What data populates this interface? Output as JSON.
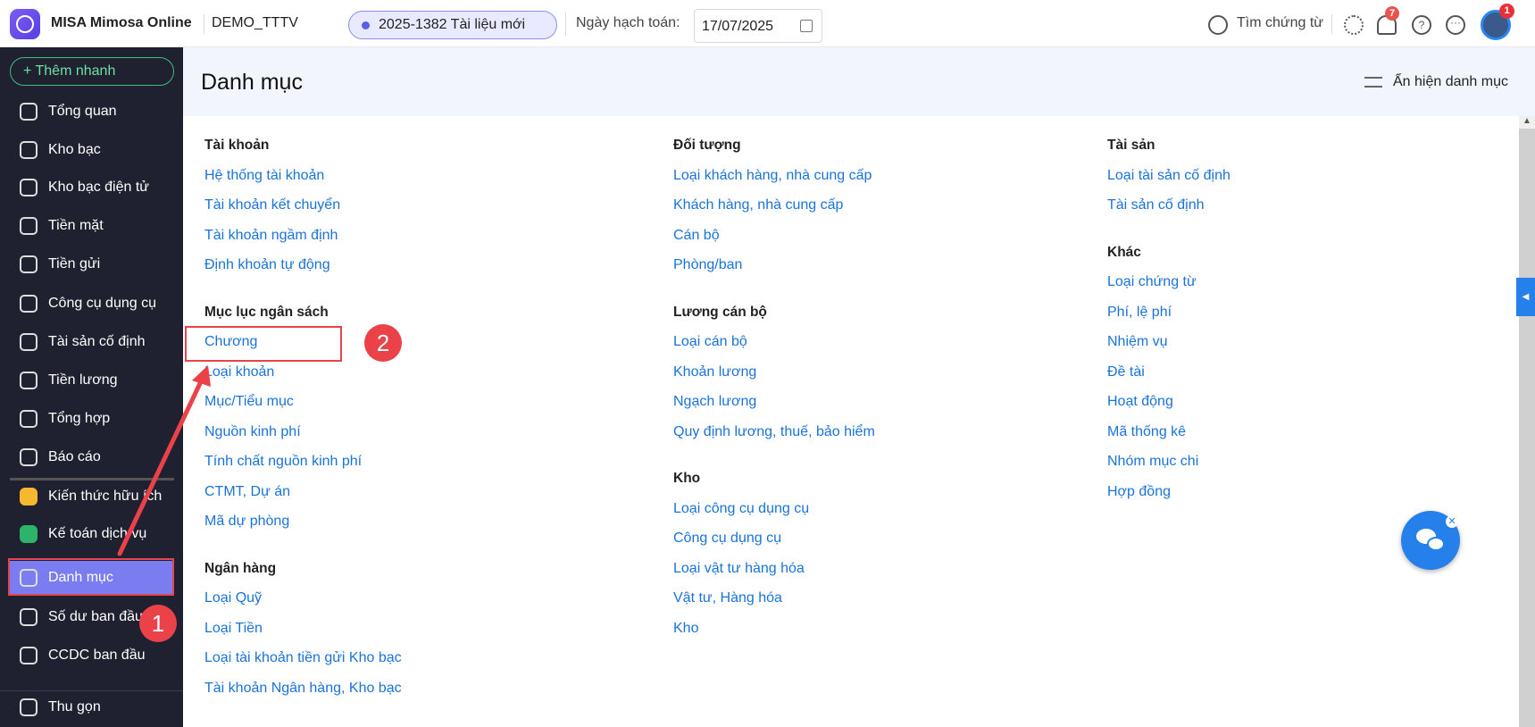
{
  "header": {
    "app_name": "MISA Mimosa Online",
    "org": "DEMO_TTTV",
    "doc_pill": "2025-1382 Tài liệu mới",
    "date_label": "Ngày hạch toán:",
    "date_value": "17/07/2025",
    "search_label": "Tìm chứng từ",
    "notif_count": "7",
    "avatar_badge": "1"
  },
  "sidebar": {
    "add_label": "Thêm nhanh",
    "items": [
      "Tổng quan",
      "Kho bạc",
      "Kho bạc điện tử",
      "Tiền mặt",
      "Tiền gửi",
      "Công cụ dụng cụ",
      "Tài sản cố định",
      "Tiền lương",
      "Tổng hợp",
      "Báo cáo"
    ],
    "extra": [
      "Kiến thức hữu ích",
      "Kế toán dịch vụ",
      "Danh mục",
      "Số dư ban đầu",
      "CCDC ban đầu"
    ],
    "collapse_label": "Thu gọn"
  },
  "main": {
    "title": "Danh mục",
    "toggle_label": "Ẩn hiện danh mục",
    "columns": [
      [
        {
          "h": "Tài khoản",
          "links": [
            "Hệ thống tài khoản",
            "Tài khoản kết chuyển",
            "Tài khoản ngầm định",
            "Định khoản tự động"
          ]
        },
        {
          "h": "Mục lục ngân sách",
          "links": [
            "Chương",
            "Loại khoản",
            "Mục/Tiểu mục",
            "Nguồn kinh phí",
            "Tính chất nguồn kinh phí",
            "CTMT, Dự án",
            "Mã dự phòng"
          ]
        },
        {
          "h": "Ngân hàng",
          "links": [
            "Loại Quỹ",
            "Loại Tiền",
            "Loại tài khoản tiền gửi Kho bạc",
            "Tài khoản Ngân hàng, Kho bạc"
          ]
        }
      ],
      [
        {
          "h": "Đối tượng",
          "links": [
            "Loại khách hàng, nhà cung cấp",
            "Khách hàng, nhà cung cấp",
            "Cán bộ",
            "Phòng/ban"
          ]
        },
        {
          "h": "Lương cán bộ",
          "links": [
            "Loại cán bộ",
            "Khoản lương",
            "Ngạch lương",
            "Quy định lương, thuế, bảo hiểm"
          ]
        },
        {
          "h": "Kho",
          "links": [
            "Loại công cụ dụng cụ",
            "Công cụ dụng cụ",
            "Loại vật tư hàng hóa",
            "Vật tư, Hàng hóa",
            "Kho"
          ]
        }
      ],
      [
        {
          "h": "Tài sản",
          "links": [
            "Loại tài sản cố định",
            "Tài sản cố định"
          ]
        },
        {
          "h": "Khác",
          "links": [
            "Loại chứng từ",
            "Phí, lệ phí",
            "Nhiệm vụ",
            "Đề tài",
            "Hoạt động",
            "Mã thống kê",
            "Nhóm mục chi",
            "Hợp đồng"
          ]
        }
      ]
    ]
  },
  "annotations": {
    "step1": "1",
    "step2": "2"
  }
}
